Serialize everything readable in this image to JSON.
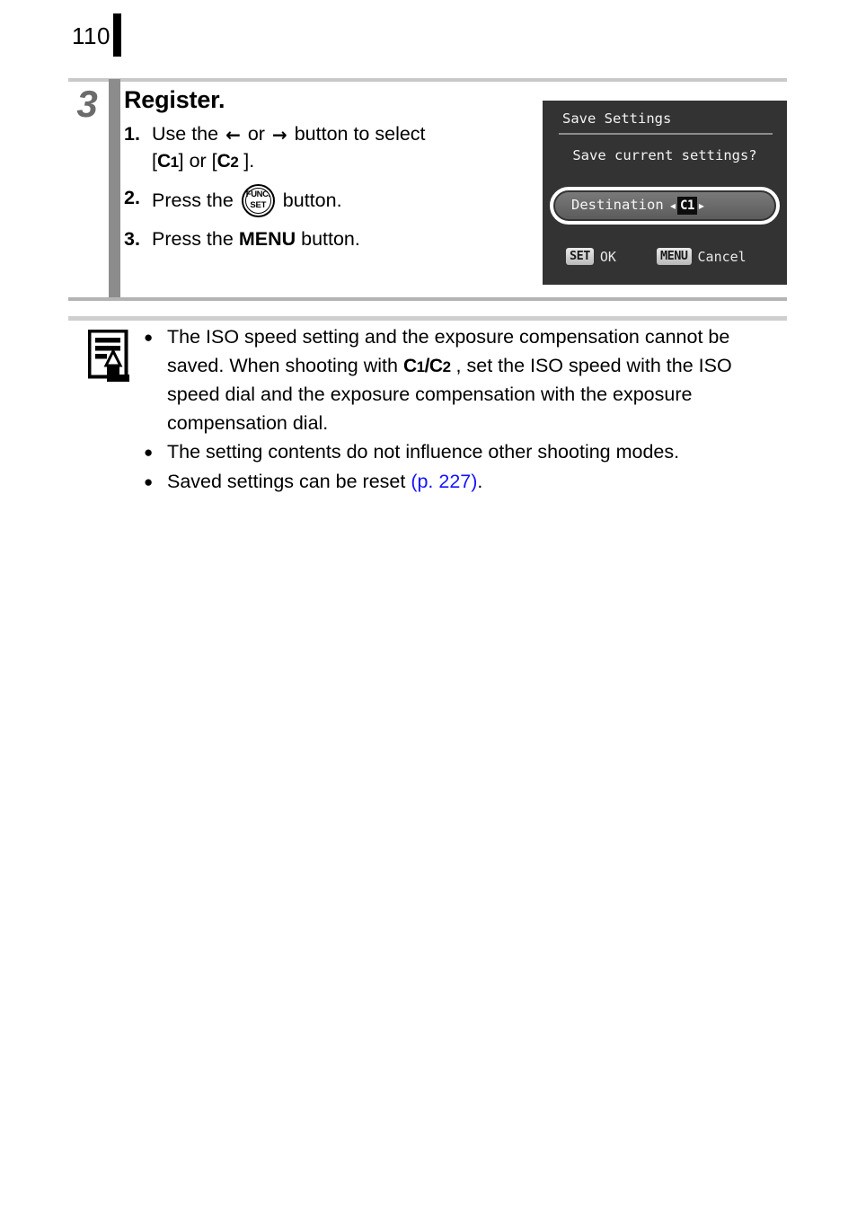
{
  "page": {
    "number": "110",
    "tab_mark": "black-tab"
  },
  "step": {
    "number": "3",
    "title": "Register.",
    "substeps": [
      {
        "num": "1.",
        "line1_before": "Use the",
        "icon_left": "left-arrow-icon",
        "icon_left_glyph": "←",
        "between": "or",
        "icon_right": "right-arrow-icon",
        "icon_right_glyph": "→",
        "line1_after": "button to select",
        "line2_prefix": "[",
        "line2_mode1_letter": "C",
        "line2_mode1_num": "1",
        "line2_mid": "] or [",
        "line2_mode2_letter": "C",
        "line2_mode2_num": "2",
        "line2_suffix": " ]."
      },
      {
        "num": "2.",
        "before": "Press the",
        "icon": "func-set-button-icon",
        "icon_top_label": "FUNC.",
        "icon_bottom_label": "SET",
        "after": "button."
      },
      {
        "num": "3.",
        "before": "Press the",
        "bold_word": "MENU",
        "after": "button."
      }
    ]
  },
  "lcd": {
    "title": "Save Settings",
    "question": "Save current settings?",
    "row": {
      "label": "Destination",
      "arrow_left": "◂",
      "arrow_right": "▸",
      "value": "C1"
    },
    "footer": {
      "set_key": "SET",
      "set_label": "OK",
      "menu_key": "MENU",
      "menu_label": "Cancel"
    },
    "colors": {
      "background": "#333333",
      "row_highlight": "#6b6b6b",
      "outline": "#ffffff",
      "value_badge": "#0d0d0d"
    }
  },
  "note": {
    "icon": "note-pencil-icon",
    "bullets": [
      {
        "seg1": "The ISO speed setting and the exposure compensation cannot be saved. When shooting with ",
        "mode1_letter": "C",
        "mode1_num": "1",
        "slash": "/",
        "mode2_letter": "C",
        "mode2_num": "2",
        "seg2": " , set the ISO speed with the ISO speed dial and the exposure compensation with the exposure compensation dial."
      },
      {
        "seg1": "The setting contents do not influence other shooting modes."
      },
      {
        "seg1": "Saved settings can be reset ",
        "link": "(p. 227)",
        "seg2": "."
      }
    ]
  },
  "colors": {
    "rule_top": "#c9c9c9",
    "rule_mid": "#b4b4b4",
    "rule_note": "#cfcfcf",
    "step_bar": "#8c8c8c",
    "step_number": "#6b6b6b",
    "link": "#1414ff"
  }
}
